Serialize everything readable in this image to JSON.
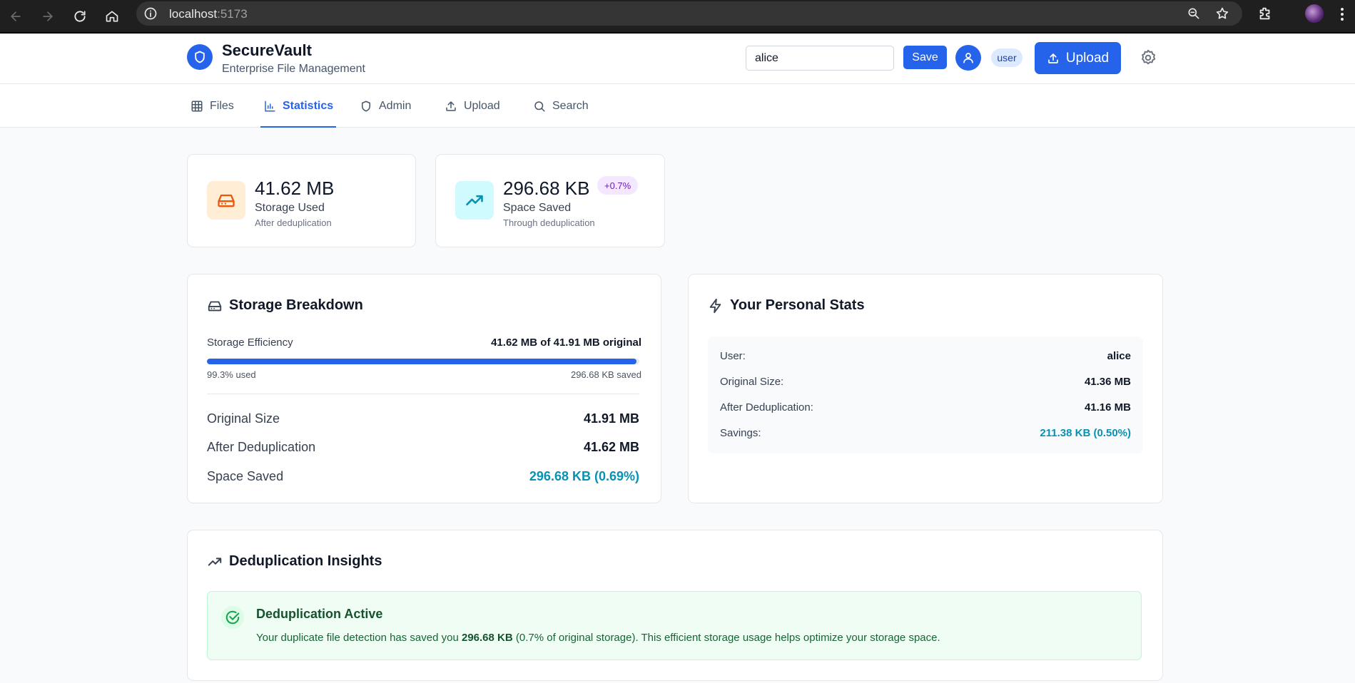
{
  "browser": {
    "url_host": "localhost",
    "url_port": ":5173"
  },
  "header": {
    "title": "SecureVault",
    "subtitle": "Enterprise File Management",
    "user_input_value": "alice",
    "save_label": "Save",
    "role_badge": "user",
    "upload_label": "Upload"
  },
  "tabs": [
    {
      "label": "Files",
      "icon": "grid-icon",
      "active": false
    },
    {
      "label": "Statistics",
      "icon": "bar-chart-icon",
      "active": true
    },
    {
      "label": "Admin",
      "icon": "shield-icon",
      "active": false
    },
    {
      "label": "Upload",
      "icon": "upload-icon",
      "active": false
    },
    {
      "label": "Search",
      "icon": "search-icon",
      "active": false
    }
  ],
  "stats": {
    "storage_used": {
      "value": "41.62 MB",
      "label": "Storage Used",
      "sub": "After deduplication",
      "icon": "hard-drive-icon",
      "color": "#ea580c"
    },
    "space_saved": {
      "value": "296.68 KB",
      "label": "Space Saved",
      "sub": "Through deduplication",
      "badge": "+0.7%",
      "icon": "trending-up-icon",
      "color": "#0891b2"
    }
  },
  "breakdown": {
    "title": "Storage Breakdown",
    "efficiency_label": "Storage Efficiency",
    "efficiency_value": "41.62 MB of 41.91 MB original",
    "used_fraction": 0.993,
    "used_text": "99.3% used",
    "saved_text": "296.68 KB saved",
    "rows": [
      {
        "label": "Original Size",
        "value": "41.91 MB"
      },
      {
        "label": "After Deduplication",
        "value": "41.62 MB"
      },
      {
        "label": "Space Saved",
        "value": "296.68 KB (0.69%)"
      }
    ]
  },
  "personal": {
    "title": "Your Personal Stats",
    "rows": [
      {
        "label": "User:",
        "value": "alice"
      },
      {
        "label": "Original Size:",
        "value": "41.36 MB"
      },
      {
        "label": "After Deduplication:",
        "value": "41.16 MB"
      },
      {
        "label": "Savings:",
        "value": "211.38 KB (0.50%)"
      }
    ]
  },
  "insights": {
    "title": "Deduplication Insights",
    "status_title": "Deduplication Active",
    "text_before": "Your duplicate file detection has saved you ",
    "text_bold": "296.68 KB",
    "text_after": " (0.7% of original storage). This efficient storage usage helps optimize your storage space."
  },
  "colors": {
    "primary": "#2563eb",
    "teal": "#0891b2",
    "success_bg": "#f0fdf4",
    "success_text": "#14532d"
  }
}
